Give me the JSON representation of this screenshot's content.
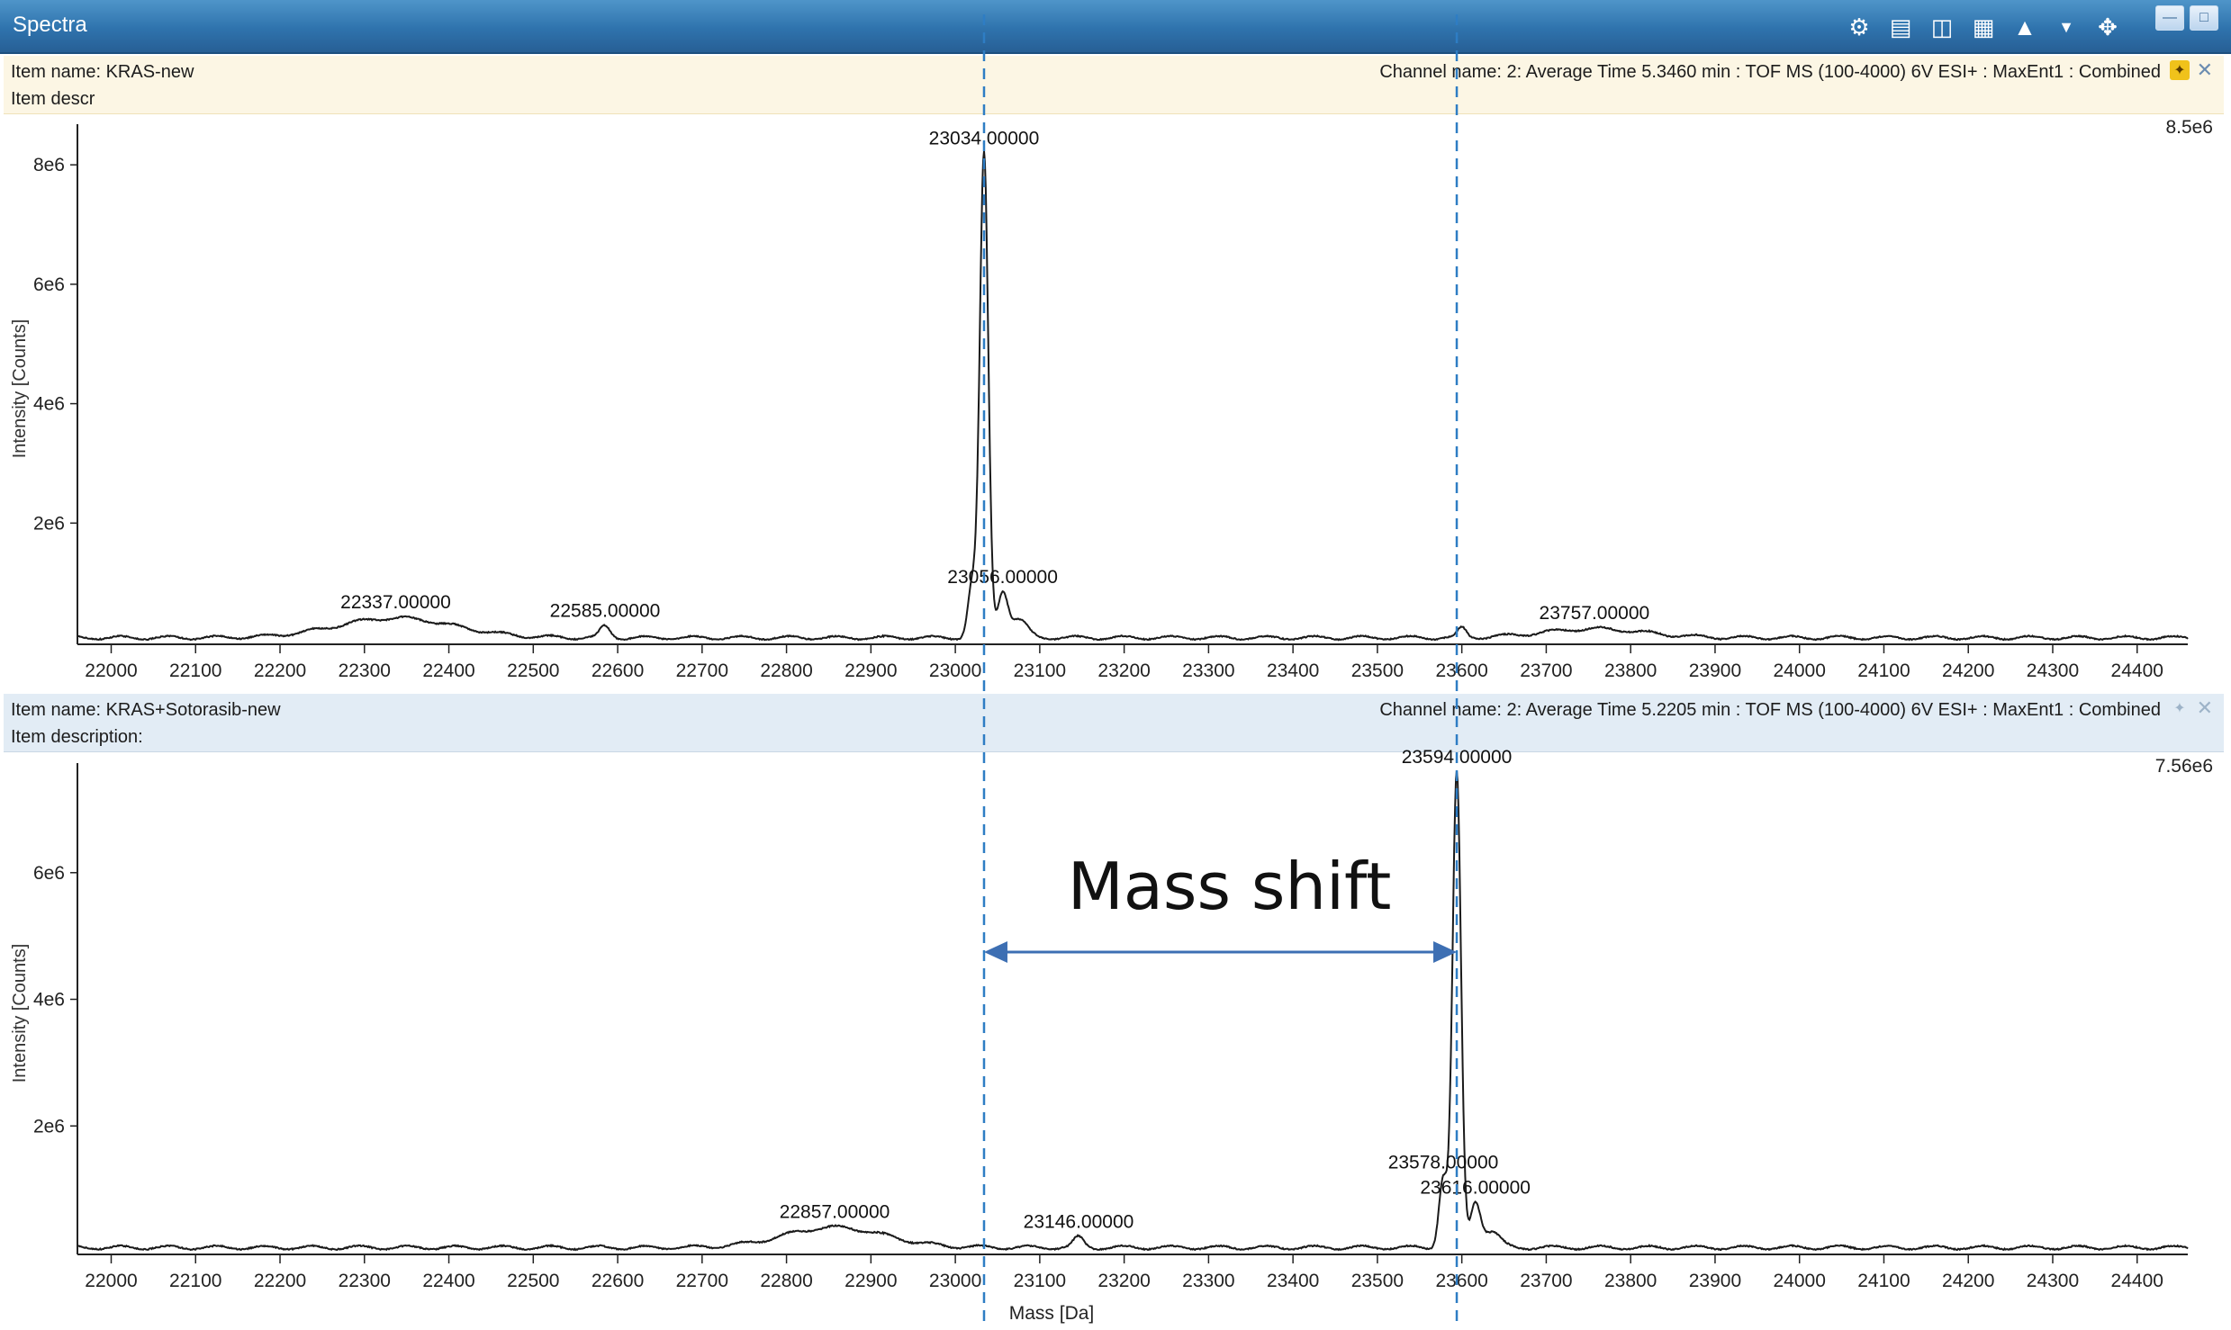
{
  "window": {
    "title": "Spectra",
    "toolbar_icons": [
      "peak-pick-icon",
      "report-icon",
      "export-icon",
      "table-icon",
      "chart-icon",
      "dropdown-arrow-icon",
      "move-icon"
    ],
    "buttons": [
      "minimize-icon",
      "restore-icon"
    ]
  },
  "top_panel": {
    "item_name": "Item name: KRAS-new",
    "item_desc": "Item descr",
    "channel": "Channel name: 2: Average Time 5.3460 min : TOF MS (100-4000) 6V ESI+ : MaxEnt1 : Combined",
    "max_label": "8.5e6",
    "ylabel": "Intensity [Counts]"
  },
  "bottom_panel": {
    "item_name": "Item name: KRAS+Sotorasib-new",
    "item_desc": "Item description:",
    "channel": "Channel name: 2: Average Time 5.2205 min : TOF MS (100-4000) 6V ESI+ : MaxEnt1 : Combined",
    "max_label": "7.56e6",
    "ylabel": "Intensity [Counts]",
    "xlabel": "Mass [Da]"
  },
  "annotation": {
    "text": "Mass shift",
    "from_mass": 23034,
    "to_mass": 23594
  },
  "colors": {
    "titlebar": "#2f73ad",
    "guide": "#2e7dc4",
    "arrow": "#3d6fb3",
    "trace": "#1a1a1a"
  },
  "chart_data": [
    {
      "type": "line",
      "title": "",
      "xlabel": "",
      "ylabel": "Intensity [Counts]",
      "xlim": [
        21960,
        24460
      ],
      "ylim": [
        0,
        8500000
      ],
      "x_ticks": [
        22000,
        22100,
        22200,
        22300,
        22400,
        22500,
        22600,
        22700,
        22800,
        22900,
        23000,
        23100,
        23200,
        23300,
        23400,
        23500,
        23600,
        23700,
        23800,
        23900,
        24000,
        24100,
        24200,
        24300,
        24400
      ],
      "y_ticks": [
        2000000,
        4000000,
        6000000,
        8000000
      ],
      "y_tick_labels": [
        "2e6",
        "4e6",
        "6e6",
        "8e6"
      ],
      "baseline": 80000,
      "peaks": [
        {
          "mass": 22337,
          "intensity": 330000,
          "width": 70
        },
        {
          "mass": 22585,
          "intensity": 190000,
          "width": 6
        },
        {
          "mass": 23020,
          "intensity": 900000,
          "width": 5
        },
        {
          "mass": 23034,
          "intensity": 8100000,
          "width": 5
        },
        {
          "mass": 23056,
          "intensity": 750000,
          "width": 6
        },
        {
          "mass": 23075,
          "intensity": 300000,
          "width": 10
        },
        {
          "mass": 23600,
          "intensity": 160000,
          "width": 5
        },
        {
          "mass": 23757,
          "intensity": 150000,
          "width": 60
        }
      ],
      "labels": [
        {
          "mass": 22337,
          "intensity": 330000,
          "text": "22337.00000"
        },
        {
          "mass": 22585,
          "intensity": 190000,
          "text": "22585.00000"
        },
        {
          "mass": 23034,
          "intensity": 8100000,
          "text": "23034.00000"
        },
        {
          "mass": 23056,
          "intensity": 750000,
          "text": "23056.00000"
        },
        {
          "mass": 23757,
          "intensity": 150000,
          "text": "23757.00000"
        }
      ]
    },
    {
      "type": "line",
      "title": "",
      "xlabel": "Mass [Da]",
      "ylabel": "Intensity [Counts]",
      "xlim": [
        21960,
        24460
      ],
      "ylim": [
        0,
        7560000
      ],
      "x_ticks": [
        22000,
        22100,
        22200,
        22300,
        22400,
        22500,
        22600,
        22700,
        22800,
        22900,
        23000,
        23100,
        23200,
        23300,
        23400,
        23500,
        23600,
        23700,
        23800,
        23900,
        24000,
        24100,
        24200,
        24300,
        24400
      ],
      "y_ticks": [
        2000000,
        4000000,
        6000000
      ],
      "y_tick_labels": [
        "2e6",
        "4e6",
        "6e6"
      ],
      "baseline": 80000,
      "peaks": [
        {
          "mass": 22857,
          "intensity": 320000,
          "width": 60
        },
        {
          "mass": 23146,
          "intensity": 160000,
          "width": 6
        },
        {
          "mass": 23578,
          "intensity": 1100000,
          "width": 5
        },
        {
          "mass": 23594,
          "intensity": 7500000,
          "width": 5
        },
        {
          "mass": 23616,
          "intensity": 700000,
          "width": 6
        },
        {
          "mass": 23635,
          "intensity": 250000,
          "width": 10
        }
      ],
      "labels": [
        {
          "mass": 22857,
          "intensity": 320000,
          "text": "22857.00000"
        },
        {
          "mass": 23146,
          "intensity": 160000,
          "text": "23146.00000"
        },
        {
          "mass": 23578,
          "intensity": 1100000,
          "text": "23578.00000"
        },
        {
          "mass": 23594,
          "intensity": 7500000,
          "text": "23594.00000"
        },
        {
          "mass": 23616,
          "intensity": 700000,
          "text": "23616.00000"
        }
      ]
    }
  ]
}
